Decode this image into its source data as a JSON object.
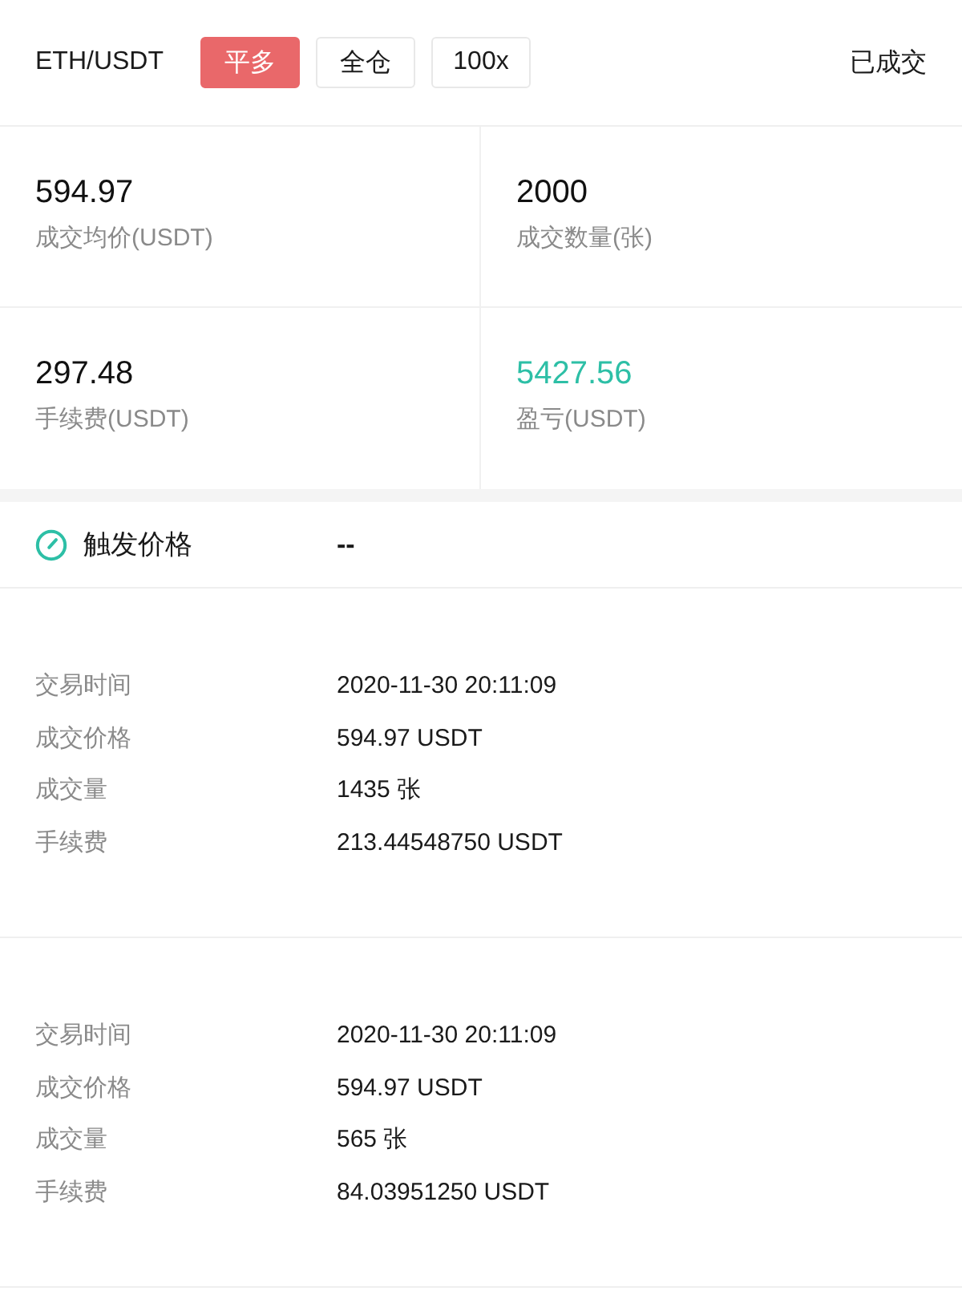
{
  "header": {
    "pair": "ETH/USDT",
    "tags": [
      {
        "label": "平多",
        "kind": "filled"
      },
      {
        "label": "全仓",
        "kind": "outline"
      },
      {
        "label": "100x",
        "kind": "outline"
      }
    ],
    "status": "已成交"
  },
  "stats": [
    {
      "value": "594.97",
      "label": "成交均价(USDT)",
      "color": "#111111"
    },
    {
      "value": "2000",
      "label": "成交数量(张)",
      "color": "#111111"
    },
    {
      "value": "297.48",
      "label": "手续费(USDT)",
      "color": "#111111"
    },
    {
      "value": "5427.56",
      "label": "盈亏(USDT)",
      "color": "#2dbfa6"
    }
  ],
  "trigger": {
    "label": "触发价格",
    "value": "--"
  },
  "fills": [
    {
      "rows": [
        {
          "label": "交易时间",
          "value": "2020-11-30 20:11:09"
        },
        {
          "label": "成交价格",
          "value": "594.97 USDT"
        },
        {
          "label": "成交量",
          "value": "1435 张"
        },
        {
          "label": "手续费",
          "value": "213.44548750 USDT"
        }
      ]
    },
    {
      "rows": [
        {
          "label": "交易时间",
          "value": "2020-11-30 20:11:09"
        },
        {
          "label": "成交价格",
          "value": "594.97 USDT"
        },
        {
          "label": "成交量",
          "value": "565 张"
        },
        {
          "label": "手续费",
          "value": "84.03951250 USDT"
        }
      ]
    }
  ]
}
